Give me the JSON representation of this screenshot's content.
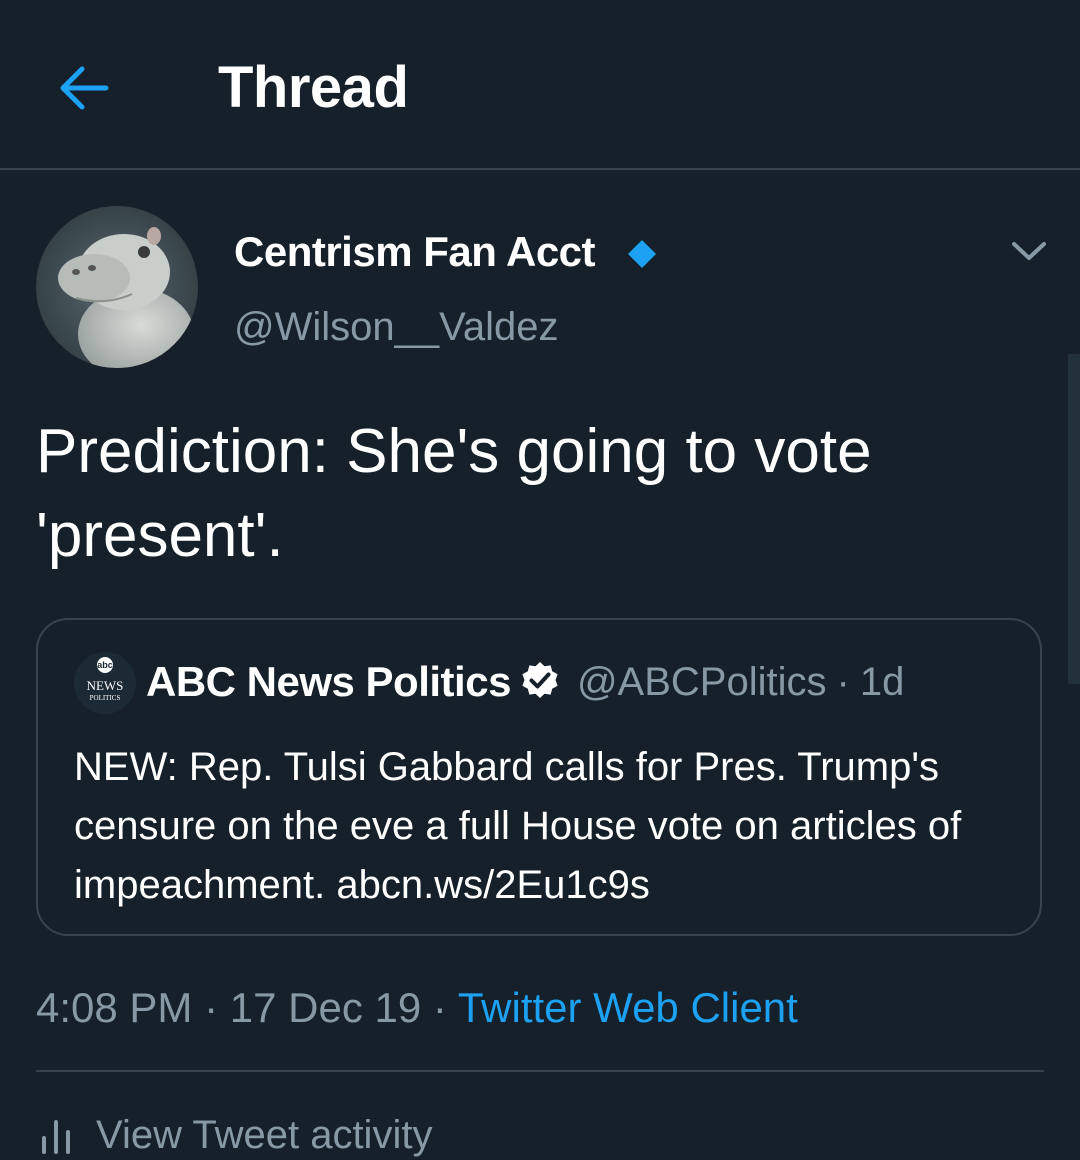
{
  "header": {
    "back_icon": "arrow-left-icon",
    "title": "Thread"
  },
  "tweet": {
    "display_name": "Centrism Fan Acct",
    "verified_icon": "blue-diamond-icon",
    "handle": "@Wilson__Valdez",
    "menu_icon": "chevron-down-icon",
    "text": "Prediction: She's going to vote 'present'.",
    "quote": {
      "logo_top": "abc",
      "logo_mid": "NEWS",
      "logo_bottom": "POLITICS",
      "name": "ABC News Politics",
      "verified_icon": "verified-badge-icon",
      "handle": "@ABCPolitics",
      "separator": "·",
      "time": "1d",
      "text": "NEW: Rep. Tulsi Gabbard calls for Pres. Trump's censure on the eve a full House vote on articles of impeachment. abcn.ws/2Eu1c9s"
    },
    "meta": {
      "time": "4:08 PM",
      "separator": "·",
      "date": "17 Dec 19",
      "source": "Twitter Web Client"
    },
    "activity_label": "View Tweet activity"
  },
  "colors": {
    "background": "#15202b",
    "accent": "#1da1f2",
    "secondary_text": "#8899a6",
    "border": "#38444d"
  }
}
